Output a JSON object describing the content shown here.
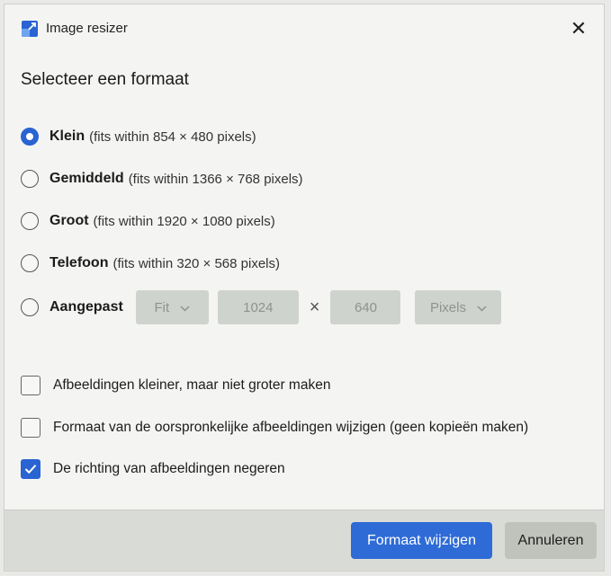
{
  "window": {
    "title": "Image resizer",
    "close_label": "✕"
  },
  "heading": "Selecteer een formaat",
  "size_options": [
    {
      "name": "Klein",
      "desc": "(fits within 854 × 480 pixels)",
      "selected": true
    },
    {
      "name": "Gemiddeld",
      "desc": "(fits within 1366 × 768 pixels)",
      "selected": false
    },
    {
      "name": "Groot",
      "desc": "(fits within 1920 × 1080 pixels)",
      "selected": false
    },
    {
      "name": "Telefoon",
      "desc": "(fits within 320 × 568 pixels)",
      "selected": false
    }
  ],
  "custom": {
    "name": "Aangepast",
    "fit_value": "Fit",
    "width": "1024",
    "times": "×",
    "height": "640",
    "unit": "Pixels",
    "enabled": false
  },
  "checkboxes": [
    {
      "label": "Afbeeldingen kleiner, maar niet groter maken",
      "checked": false
    },
    {
      "label": "Formaat van de oorspronkelijke afbeeldingen wijzigen (geen kopieën maken)",
      "checked": false
    },
    {
      "label": "De richting van afbeeldingen negeren",
      "checked": true
    }
  ],
  "footer": {
    "primary_label": "Formaat wijzigen",
    "secondary_label": "Annuleren"
  },
  "colors": {
    "accent": "#2a63d2",
    "disabled_field": "#cfd3cd"
  },
  "icons": {
    "app": "image-resizer-icon",
    "close": "close-icon",
    "dropdown": "chevron-down-icon",
    "check": "checkmark-icon"
  }
}
